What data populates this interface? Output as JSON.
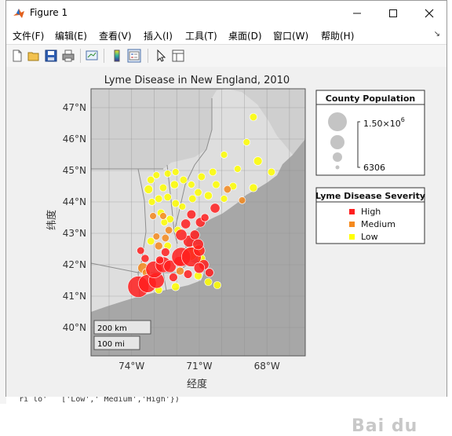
{
  "window": {
    "title": "Figure 1"
  },
  "menu": [
    "文件(F)",
    "编辑(E)",
    "查看(V)",
    "插入(I)",
    "工具(T)",
    "桌面(D)",
    "窗口(W)",
    "帮助(H)"
  ],
  "toolbar_icons": [
    "new-figure-icon",
    "open-file-icon",
    "save-icon",
    "print-icon",
    "link-plot-icon",
    "colorbar-icon",
    "legend-icon",
    "edit-plot-icon",
    "property-inspector-icon"
  ],
  "background_code": {
    "bottom_line": "    ri lo'   ['Low',' Medium','High'})"
  },
  "chart_data": {
    "type": "scatter",
    "title": "Lyme Disease in New England, 2010",
    "xlabel": "经度",
    "ylabel": "纬度",
    "xlim": [
      -75.8,
      -66.3
    ],
    "ylim": [
      39.1,
      47.6
    ],
    "xticks": [
      "74°W",
      "71°W",
      "68°W"
    ],
    "yticks": [
      "40°N",
      "41°N",
      "42°N",
      "43°N",
      "44°N",
      "45°N",
      "46°N",
      "47°N"
    ],
    "grid": true,
    "scalebar": [
      "200 km",
      "100 mi"
    ],
    "legends": {
      "size": {
        "title": "County Population",
        "max_label": "1.50×10",
        "max_exp": "6",
        "min_label": "6306"
      },
      "severity": {
        "title": "Lyme Disease Severity",
        "entries": [
          {
            "name": "High",
            "color": "#ff1f1f"
          },
          {
            "name": "Medium",
            "color": "#f58a1e"
          },
          {
            "name": "Low",
            "color": "#ffff00"
          }
        ]
      }
    },
    "series": [
      {
        "name": "High",
        "color": "#ff1f1f",
        "points": [
          [
            -73.7,
            41.3,
            1.5
          ],
          [
            -73.3,
            41.4,
            1.2
          ],
          [
            -72.9,
            41.5,
            1.0
          ],
          [
            -73.0,
            41.85,
            1.1
          ],
          [
            -72.6,
            42.0,
            1.0
          ],
          [
            -72.3,
            41.95,
            0.7
          ],
          [
            -71.9,
            42.1,
            0.5
          ],
          [
            -71.8,
            42.25,
            1.3
          ],
          [
            -71.35,
            42.25,
            1.35
          ],
          [
            -71.0,
            42.45,
            0.6
          ],
          [
            -70.8,
            42.0,
            0.5
          ],
          [
            -71.0,
            41.9,
            0.55
          ],
          [
            -70.55,
            41.75,
            0.35
          ],
          [
            -72.5,
            42.4,
            0.35
          ],
          [
            -73.4,
            42.2,
            0.3
          ],
          [
            -73.6,
            42.45,
            0.25
          ],
          [
            -72.75,
            42.15,
            0.3
          ],
          [
            -71.45,
            42.75,
            0.65
          ],
          [
            -71.05,
            42.65,
            0.55
          ],
          [
            -71.6,
            43.3,
            0.45
          ],
          [
            -71.35,
            43.6,
            0.4
          ],
          [
            -70.95,
            43.35,
            0.45
          ],
          [
            -70.75,
            43.5,
            0.3
          ],
          [
            -70.3,
            43.8,
            0.45
          ],
          [
            -71.8,
            42.95,
            0.6
          ],
          [
            -71.2,
            42.95,
            0.45
          ],
          [
            -72.15,
            41.6,
            0.35
          ],
          [
            -71.5,
            41.7,
            0.35
          ]
        ]
      },
      {
        "name": "Medium",
        "color": "#f58a1e",
        "points": [
          [
            -73.5,
            41.9,
            0.5
          ],
          [
            -72.8,
            42.6,
            0.3
          ],
          [
            -72.9,
            42.9,
            0.2
          ],
          [
            -72.5,
            42.85,
            0.25
          ],
          [
            -72.35,
            43.1,
            0.25
          ],
          [
            -73.05,
            43.55,
            0.2
          ],
          [
            -72.6,
            43.55,
            0.2
          ],
          [
            -71.4,
            42.35,
            0.8
          ],
          [
            -71.85,
            41.8,
            0.3
          ],
          [
            -73.35,
            41.75,
            0.3
          ],
          [
            -69.75,
            44.4,
            0.25
          ],
          [
            -69.1,
            44.05,
            0.2
          ]
        ]
      },
      {
        "name": "Low",
        "color": "#ffff00",
        "points": [
          [
            -68.6,
            46.7,
            0.25
          ],
          [
            -68.9,
            45.9,
            0.2
          ],
          [
            -68.4,
            45.3,
            0.35
          ],
          [
            -69.9,
            45.5,
            0.2
          ],
          [
            -70.4,
            44.95,
            0.25
          ],
          [
            -69.3,
            45.05,
            0.2
          ],
          [
            -70.9,
            44.8,
            0.25
          ],
          [
            -70.6,
            44.2,
            0.3
          ],
          [
            -70.25,
            44.55,
            0.25
          ],
          [
            -69.5,
            44.5,
            0.25
          ],
          [
            -68.6,
            44.45,
            0.3
          ],
          [
            -69.9,
            44.1,
            0.2
          ],
          [
            -67.8,
            44.95,
            0.25
          ],
          [
            -71.7,
            44.7,
            0.25
          ],
          [
            -72.1,
            44.55,
            0.3
          ],
          [
            -71.35,
            44.55,
            0.2
          ],
          [
            -71.05,
            44.3,
            0.25
          ],
          [
            -72.4,
            44.9,
            0.2
          ],
          [
            -72.05,
            44.95,
            0.2
          ],
          [
            -72.6,
            44.45,
            0.25
          ],
          [
            -72.9,
            44.85,
            0.2
          ],
          [
            -73.15,
            44.7,
            0.25
          ],
          [
            -73.25,
            44.4,
            0.35
          ],
          [
            -72.8,
            44.1,
            0.25
          ],
          [
            -72.4,
            44.15,
            0.25
          ],
          [
            -73.1,
            44.0,
            0.2
          ],
          [
            -72.7,
            43.65,
            0.25
          ],
          [
            -72.3,
            43.45,
            0.25
          ],
          [
            -71.75,
            43.85,
            0.2
          ],
          [
            -72.05,
            43.95,
            0.25
          ],
          [
            -71.3,
            44.1,
            0.25
          ],
          [
            -72.55,
            43.35,
            0.2
          ],
          [
            -71.95,
            43.1,
            0.25
          ],
          [
            -72.4,
            42.6,
            0.25
          ],
          [
            -73.15,
            42.75,
            0.25
          ],
          [
            -71.1,
            42.45,
            0.6
          ],
          [
            -70.9,
            42.2,
            0.25
          ],
          [
            -71.05,
            41.65,
            0.3
          ],
          [
            -70.6,
            41.45,
            0.25
          ],
          [
            -70.2,
            41.35,
            0.25
          ],
          [
            -72.05,
            41.3,
            0.3
          ],
          [
            -72.8,
            41.2,
            0.25
          ]
        ]
      }
    ]
  }
}
